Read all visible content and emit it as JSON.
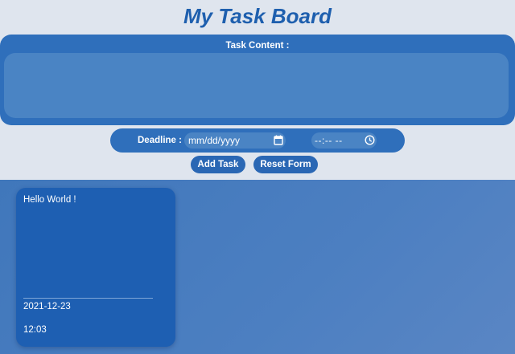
{
  "app": {
    "title": "My Task Board"
  },
  "form": {
    "content_label": "Task Content :",
    "content_value": "",
    "deadline_label": "Deadline :",
    "date_placeholder": "mm/dd/yyyy",
    "time_placeholder": "--:-- --",
    "add_button": "Add Task",
    "reset_button": "Reset Form"
  },
  "tasks": [
    {
      "content": "Hello World !",
      "date": "2021-12-23",
      "time": "12:03"
    }
  ],
  "icons": {
    "date": "calendar-icon",
    "time": "clock-icon"
  },
  "colors": {
    "accent": "#1e5fae",
    "panel": "#2f6fbb",
    "input": "#4a84c4",
    "note": "#1e5fb2",
    "background": "#dfe5ee"
  }
}
